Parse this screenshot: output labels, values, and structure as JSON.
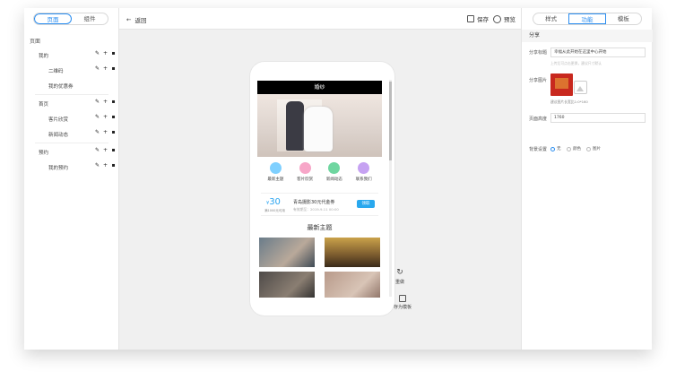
{
  "left_panel": {
    "tabs": [
      {
        "label": "页面"
      },
      {
        "label": "组件"
      }
    ],
    "section_title": "页面",
    "tree": [
      {
        "label": "我的"
      },
      {
        "label": "二维码"
      },
      {
        "label": "我的优惠券"
      },
      {
        "label": "首页"
      },
      {
        "label": "客片欣赏"
      },
      {
        "label": "新闻动态"
      },
      {
        "label": "预约"
      },
      {
        "label": "我的预约"
      }
    ]
  },
  "toolbar": {
    "back_label": "返回",
    "save_label": "保存",
    "preview_label": "预览"
  },
  "phone": {
    "header_title": "婚纱",
    "categories": [
      {
        "label": "最新主题",
        "color": "#7fd0ff"
      },
      {
        "label": "客片欣赏",
        "color": "#f7a6c8"
      },
      {
        "label": "新闻动态",
        "color": "#6fd6a0"
      },
      {
        "label": "联系我们",
        "color": "#c6a2f2"
      }
    ],
    "coupon": {
      "amount": "30",
      "condition": "满1000元可用",
      "title": "青岛摄影30元代金券",
      "date": "有效期至：2019-9-11 00:00",
      "button": "领取"
    },
    "latest_title": "最新主题"
  },
  "side_tools": {
    "reset_label": "重做",
    "save_template_label": "存为模板"
  },
  "right_panel": {
    "tabs": [
      {
        "label": "样式"
      },
      {
        "label": "功能"
      },
      {
        "label": "模板"
      }
    ],
    "section_title": "分享",
    "share_title_label": "分享标题",
    "share_title_value": "幸福从此开始在这里中心开始",
    "share_hint": "上传后可点击更换，建议尺寸默认",
    "share_image_label": "分享图片",
    "image_hint": "建议图片长宽比1:0*160",
    "page_height_label": "页面高度",
    "page_height_value": "1760",
    "background_label": "背景设置",
    "background_options": [
      {
        "label": "无"
      },
      {
        "label": "颜色"
      },
      {
        "label": "图片"
      }
    ],
    "accent_color": "#2a8df0"
  }
}
